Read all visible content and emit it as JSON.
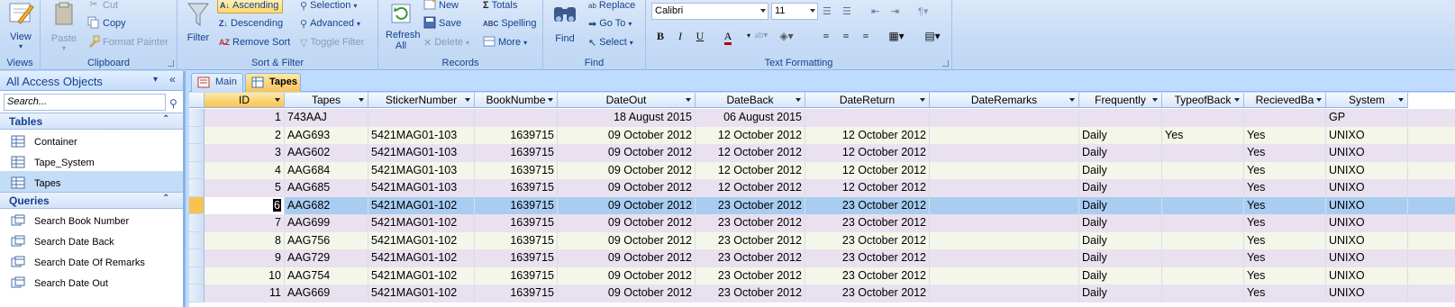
{
  "ribbon": {
    "views": {
      "label": "Views",
      "view_button": "View"
    },
    "clipboard": {
      "label": "Clipboard",
      "paste": "Paste",
      "cut": "Cut",
      "copy": "Copy",
      "format_painter": "Format Painter"
    },
    "sort_filter": {
      "label": "Sort & Filter",
      "filter": "Filter",
      "ascending": "Ascending",
      "descending": "Descending",
      "remove_sort": "Remove Sort",
      "selection": "Selection",
      "advanced": "Advanced",
      "toggle_filter": "Toggle Filter"
    },
    "records": {
      "label": "Records",
      "refresh_all": "Refresh All",
      "new": "New",
      "save": "Save",
      "delete": "Delete",
      "totals": "Totals",
      "spelling": "Spelling",
      "more": "More"
    },
    "find": {
      "label": "Find",
      "find": "Find",
      "replace": "Replace",
      "go_to": "Go To",
      "select": "Select"
    },
    "text_formatting": {
      "label": "Text Formatting",
      "font": "Calibri",
      "size": "11",
      "bold": "B",
      "italic": "I",
      "underline": "U",
      "font_color_letter": "A",
      "font_color": "#c00000"
    }
  },
  "nav": {
    "title": "All Access Objects",
    "search_placeholder": "Search...",
    "tables_header": "Tables",
    "tables": [
      "Container",
      "Tape_System",
      "Tapes"
    ],
    "queries_header": "Queries",
    "queries": [
      "Search Book Number",
      "Search Date Back",
      "Search Date Of Remarks",
      "Search Date Out"
    ]
  },
  "tabs": [
    {
      "label": "Main",
      "active": false
    },
    {
      "label": "Tapes",
      "active": true
    }
  ],
  "grid": {
    "columns": [
      "ID",
      "Tapes",
      "StickerNumber",
      "BookNumbe",
      "DateOut",
      "DateBack",
      "DateReturn",
      "DateRemarks",
      "Frequently",
      "TypeofBack",
      "RecievedBa",
      "System"
    ],
    "rows": [
      [
        "1",
        "743AAJ",
        "",
        "",
        "18 August 2015",
        "06 August 2015",
        "",
        "",
        "",
        "",
        "",
        "GP"
      ],
      [
        "2",
        "AAG693",
        "5421MAG01-103",
        "1639715",
        "09 October 2012",
        "12 October 2012",
        "12 October 2012",
        "",
        "Daily",
        "Yes",
        "Yes",
        "UNIXO"
      ],
      [
        "3",
        "AAG602",
        "5421MAG01-103",
        "1639715",
        "09 October 2012",
        "12 October 2012",
        "12 October 2012",
        "",
        "Daily",
        "",
        "Yes",
        "UNIXO"
      ],
      [
        "4",
        "AAG684",
        "5421MAG01-103",
        "1639715",
        "09 October 2012",
        "12 October 2012",
        "12 October 2012",
        "",
        "Daily",
        "",
        "Yes",
        "UNIXO"
      ],
      [
        "5",
        "AAG685",
        "5421MAG01-103",
        "1639715",
        "09 October 2012",
        "12 October 2012",
        "12 October 2012",
        "",
        "Daily",
        "",
        "Yes",
        "UNIXO"
      ],
      [
        "6",
        "AAG682",
        "5421MAG01-102",
        "1639715",
        "09 October 2012",
        "23 October 2012",
        "23 October 2012",
        "",
        "Daily",
        "",
        "Yes",
        "UNIXO"
      ],
      [
        "7",
        "AAG699",
        "5421MAG01-102",
        "1639715",
        "09 October 2012",
        "23 October 2012",
        "23 October 2012",
        "",
        "Daily",
        "",
        "Yes",
        "UNIXO"
      ],
      [
        "8",
        "AAG756",
        "5421MAG01-102",
        "1639715",
        "09 October 2012",
        "23 October 2012",
        "23 October 2012",
        "",
        "Daily",
        "",
        "Yes",
        "UNIXO"
      ],
      [
        "9",
        "AAG729",
        "5421MAG01-102",
        "1639715",
        "09 October 2012",
        "23 October 2012",
        "23 October 2012",
        "",
        "Daily",
        "",
        "Yes",
        "UNIXO"
      ],
      [
        "10",
        "AAG754",
        "5421MAG01-102",
        "1639715",
        "09 October 2012",
        "23 October 2012",
        "23 October 2012",
        "",
        "Daily",
        "",
        "Yes",
        "UNIXO"
      ],
      [
        "11",
        "AAG669",
        "5421MAG01-102",
        "1639715",
        "09 October 2012",
        "23 October 2012",
        "23 October 2012",
        "",
        "Daily",
        "",
        "Yes",
        "UNIXO"
      ]
    ],
    "selected_row": 5,
    "colors": {
      "row_even": "#e9e1ef",
      "row_odd": "#f4f6ea",
      "selected": "#a9cdf0",
      "accent": "#f8c253"
    }
  }
}
